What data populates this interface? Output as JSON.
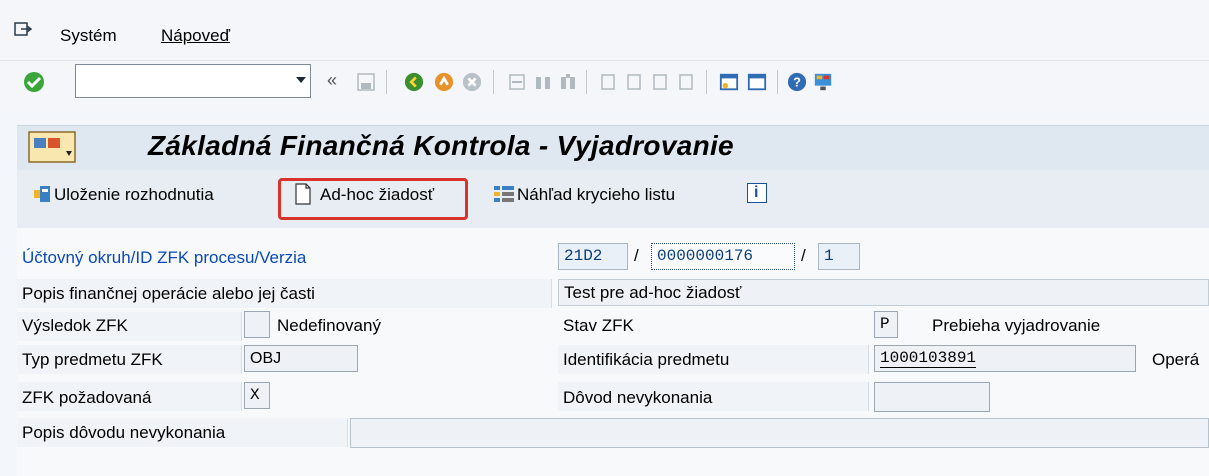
{
  "menu": {
    "system": "Systém",
    "help": "Nápoveď"
  },
  "toolbar": {
    "command_value": "",
    "collapse": "«"
  },
  "title": "Základná Finančná Kontrola - Vyjadrovanie",
  "app_toolbar": {
    "save_decision": "Uloženie rozhodnutia",
    "adhoc_request": "Ad-hoc žiadosť",
    "cover_preview": "Náhľad krycieho listu",
    "info": "i"
  },
  "form": {
    "org": {
      "label": "Účtovný okruh/ID ZFK procesu/Verzia",
      "company_code": "21D2",
      "process_id": "0000000176",
      "version": "1",
      "sep": "/"
    },
    "description": {
      "label": "Popis finančnej operácie alebo jej časti",
      "value": "Test pre ad-hoc žiadosť"
    },
    "result": {
      "label": "Výsledok ZFK",
      "code": "",
      "text": "Nedefinovaný"
    },
    "status": {
      "label": "Stav ZFK",
      "code": "P",
      "text": "Prebieha vyjadrovanie"
    },
    "subject_type": {
      "label": "Typ predmetu ZFK",
      "value": "OBJ"
    },
    "subject_id": {
      "label": "Identifikácia predmetu",
      "value": "1000103891",
      "next_label": "Operá"
    },
    "required": {
      "label": "ZFK požadovaná",
      "value": "X"
    },
    "reason": {
      "label": "Dôvod nevykonania",
      "value": ""
    },
    "reason_desc": {
      "label": "Popis dôvodu nevykonania",
      "value": ""
    }
  },
  "colors": {
    "title_bg": "#dfe8f0",
    "highlight": "#d9342b",
    "link_blue": "#0b49b8"
  }
}
